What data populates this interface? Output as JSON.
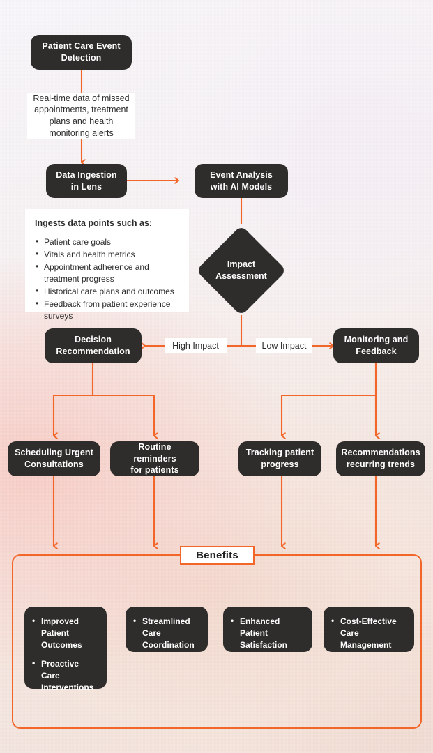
{
  "theme": {
    "accent": "#f2662a",
    "node_bg": "#2e2d2b",
    "node_text": "#ffffff",
    "panel_bg": "#ffffff",
    "panel_text": "#2b2b2b"
  },
  "nodes": {
    "patient_care_event_detection": "Patient Care Event\nDetection",
    "data_ingestion": "Data Ingestion\nin Lens",
    "event_analysis": "Event Analysis\nwith AI Models",
    "impact_assessment": "Impact\nAssessment",
    "decision_recommendation": "Decision\nRecommendation",
    "monitoring_feedback": "Monitoring and\nFeedback",
    "scheduling_urgent": "Scheduling Urgent\nConsultations",
    "routine_reminders": "Routine reminders\nfor patients",
    "tracking_progress": "Tracking patient\nprogress",
    "recommendations_trends": "Recommendations\nrecurring trends"
  },
  "notes": {
    "realtime_data": "Real-time data of missed appointments, treatment plans and health monitoring alerts"
  },
  "ingest_panel": {
    "title": "Ingests data points such as:",
    "items": [
      "Patient care goals",
      "Vitals and health metrics",
      "Appointment adherence and treatment progress",
      "Historical care plans and outcomes",
      "Feedback from patient experience surveys"
    ]
  },
  "edge_labels": {
    "high_impact": "High Impact",
    "low_impact": "Low Impact"
  },
  "benefits": {
    "title": "Benefits",
    "groups": [
      {
        "items": [
          "Improved Patient Outcomes",
          "Proactive Care Interventions"
        ]
      },
      {
        "items": [
          "Streamlined Care Coordination"
        ]
      },
      {
        "items": [
          "Enhanced Patient Satisfaction"
        ]
      },
      {
        "items": [
          "Cost-Effective Care Management"
        ]
      }
    ]
  }
}
